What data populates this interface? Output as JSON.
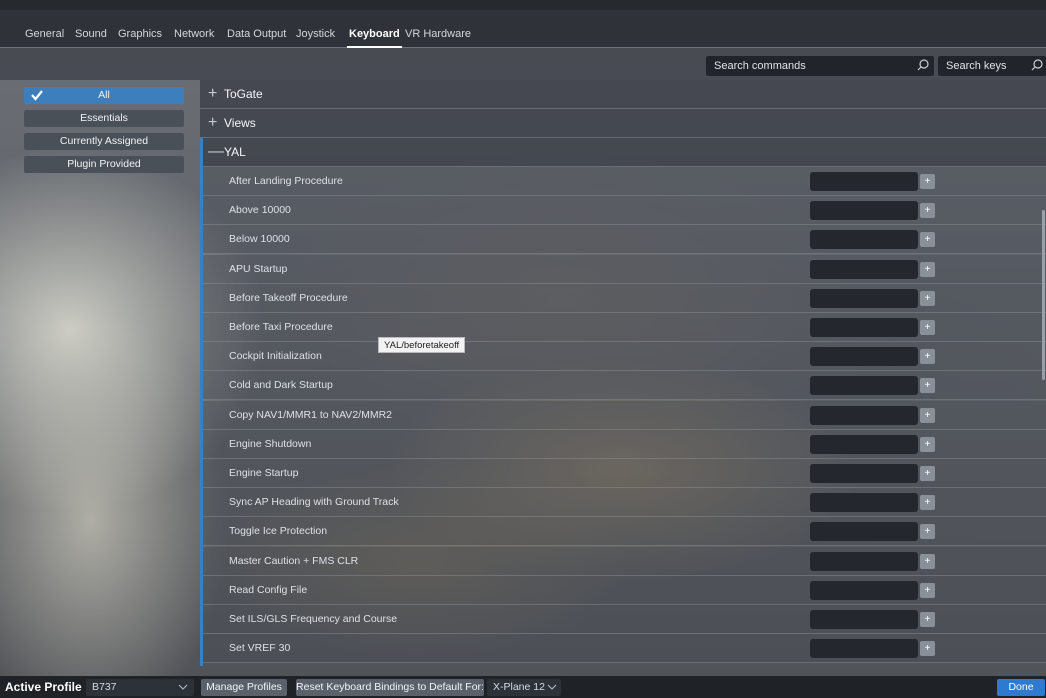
{
  "tabs": [
    {
      "label": "General"
    },
    {
      "label": "Sound"
    },
    {
      "label": "Graphics"
    },
    {
      "label": "Network"
    },
    {
      "label": "Data Output"
    },
    {
      "label": "Joystick"
    },
    {
      "label": "Keyboard",
      "active": true
    },
    {
      "label": "VR Hardware"
    }
  ],
  "search": {
    "commands_placeholder": "Search commands",
    "keys_placeholder": "Search keys"
  },
  "filters": [
    {
      "label": "All",
      "active": true
    },
    {
      "label": "Essentials"
    },
    {
      "label": "Currently Assigned"
    },
    {
      "label": "Plugin Provided"
    }
  ],
  "groups": [
    {
      "label": "ToGate",
      "expanded": false,
      "symbol": "+"
    },
    {
      "label": "Views",
      "expanded": false,
      "symbol": "+"
    },
    {
      "label": "YAL",
      "expanded": true,
      "symbol": "—"
    }
  ],
  "commands": [
    {
      "label": "After Landing Procedure",
      "key": "",
      "add": "+"
    },
    {
      "label": "Above 10000",
      "key": "",
      "add": "+"
    },
    {
      "label": "Below 10000",
      "key": "",
      "add": "+"
    },
    {
      "label": "APU Startup",
      "key": "",
      "add": "+"
    },
    {
      "label": "Before Takeoff Procedure",
      "key": "",
      "add": "+"
    },
    {
      "label": "Before Taxi Procedure",
      "key": "",
      "add": "+"
    },
    {
      "label": "Cockpit Initialization",
      "key": "",
      "add": "+"
    },
    {
      "label": "Cold and Dark Startup",
      "key": "",
      "add": "+"
    },
    {
      "label": "Copy NAV1/MMR1 to NAV2/MMR2",
      "key": "",
      "add": "+"
    },
    {
      "label": "Engine Shutdown",
      "key": "",
      "add": "+"
    },
    {
      "label": "Engine Startup",
      "key": "",
      "add": "+"
    },
    {
      "label": "Sync AP Heading with Ground Track",
      "key": "",
      "add": "+"
    },
    {
      "label": "Toggle Ice Protection",
      "key": "",
      "add": "+"
    },
    {
      "label": "Master Caution + FMS CLR",
      "key": "",
      "add": "+"
    },
    {
      "label": "Read Config File",
      "key": "",
      "add": "+"
    },
    {
      "label": "Set ILS/GLS Frequency and Course",
      "key": "",
      "add": "+"
    },
    {
      "label": "Set VREF 30",
      "key": "",
      "add": "+"
    }
  ],
  "tooltip": "YAL/beforetakeoff",
  "bottom": {
    "active_profile_label": "Active Profile",
    "profile_value": "B737",
    "manage_profiles": "Manage Profiles",
    "reset_label": "Reset Keyboard Bindings to Default For:",
    "reset_target": "X-Plane 12",
    "done": "Done"
  },
  "colors": {
    "accent": "#3d7fbd",
    "done": "#2e7ad1"
  }
}
